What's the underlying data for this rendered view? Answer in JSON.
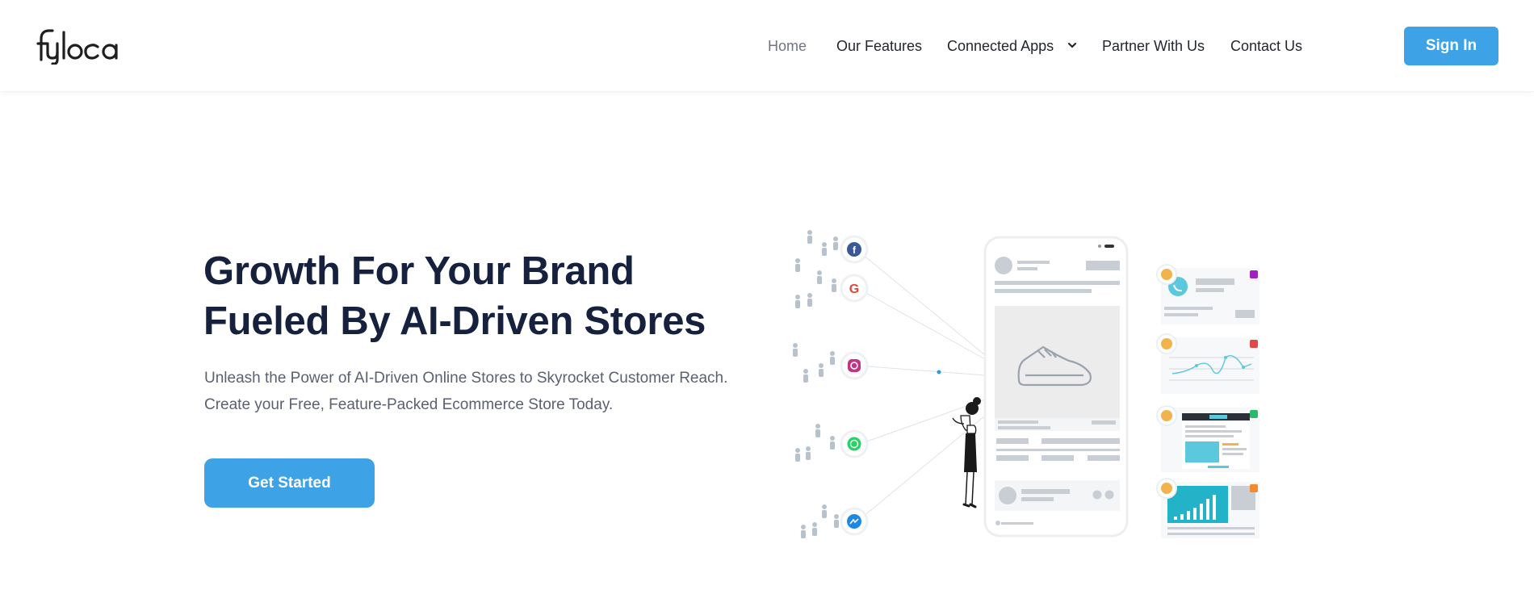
{
  "brand": {
    "logo_text": "fyloca",
    "accent_color": "#3ea3e6",
    "heading_color": "#15213d"
  },
  "nav": {
    "items": [
      {
        "label": "Home",
        "active": true
      },
      {
        "label": "Our Features"
      },
      {
        "label": "Connected Apps",
        "has_dropdown": true
      },
      {
        "label": "Partner With Us"
      },
      {
        "label": "Contact Us"
      }
    ],
    "signin_label": "Sign In"
  },
  "hero": {
    "title_line1": "Growth For Your Brand",
    "title_line2": "Fueled By AI-Driven Stores",
    "subtitle_line1": "Unleash the Power of AI-Driven Online Stores to Skyrocket Customer Reach.",
    "subtitle_line2": "Create your Free, Feature-Packed Ecommerce Store Today.",
    "cta_label": "Get Started"
  },
  "illustration": {
    "social_icons": [
      "facebook-icon",
      "google-icon",
      "instagram-icon",
      "whatsapp-icon",
      "messenger-icon"
    ],
    "center": "phone-mockup-shoe",
    "side_cards": [
      "call-card",
      "chart-card",
      "email-card",
      "bar-chart-card"
    ]
  }
}
